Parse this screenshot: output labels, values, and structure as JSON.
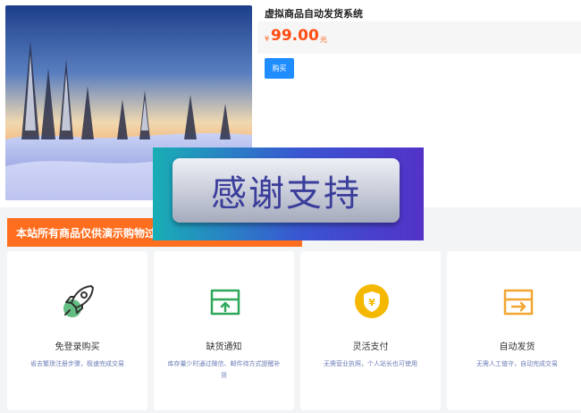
{
  "product": {
    "title": "虚拟商品自动发货系统",
    "price_currency": "¥",
    "price_value": "99.00",
    "price_unit": "元",
    "buy_label": "购买",
    "image_icon": "snowy-forest-landscape-image"
  },
  "notice": {
    "text": "本站所有商品仅供演示购物过程"
  },
  "banner": {
    "text": "感谢支持"
  },
  "features": [
    {
      "icon": "rocket-icon",
      "title": "免登录购买",
      "desc": "省去繁琐注册步骤，极速完成交易"
    },
    {
      "icon": "box-notify-icon",
      "title": "缺货通知",
      "desc": "库存量少时通过微信、邮件待方式提醒补货"
    },
    {
      "icon": "shield-coin-icon",
      "title": "灵活支付",
      "desc": "无需营业执照，个人站长也可使用"
    },
    {
      "icon": "box-deliver-icon",
      "title": "自动发货",
      "desc": "无需人工值守，自动完成交易"
    }
  ],
  "colors": {
    "accent_orange": "#ff6e1f",
    "price_red": "#ff4c12",
    "button_blue": "#1f8cff",
    "icon_green": "#2fa85a",
    "icon_yellow": "#f5b800",
    "icon_orange": "#f2a530"
  }
}
